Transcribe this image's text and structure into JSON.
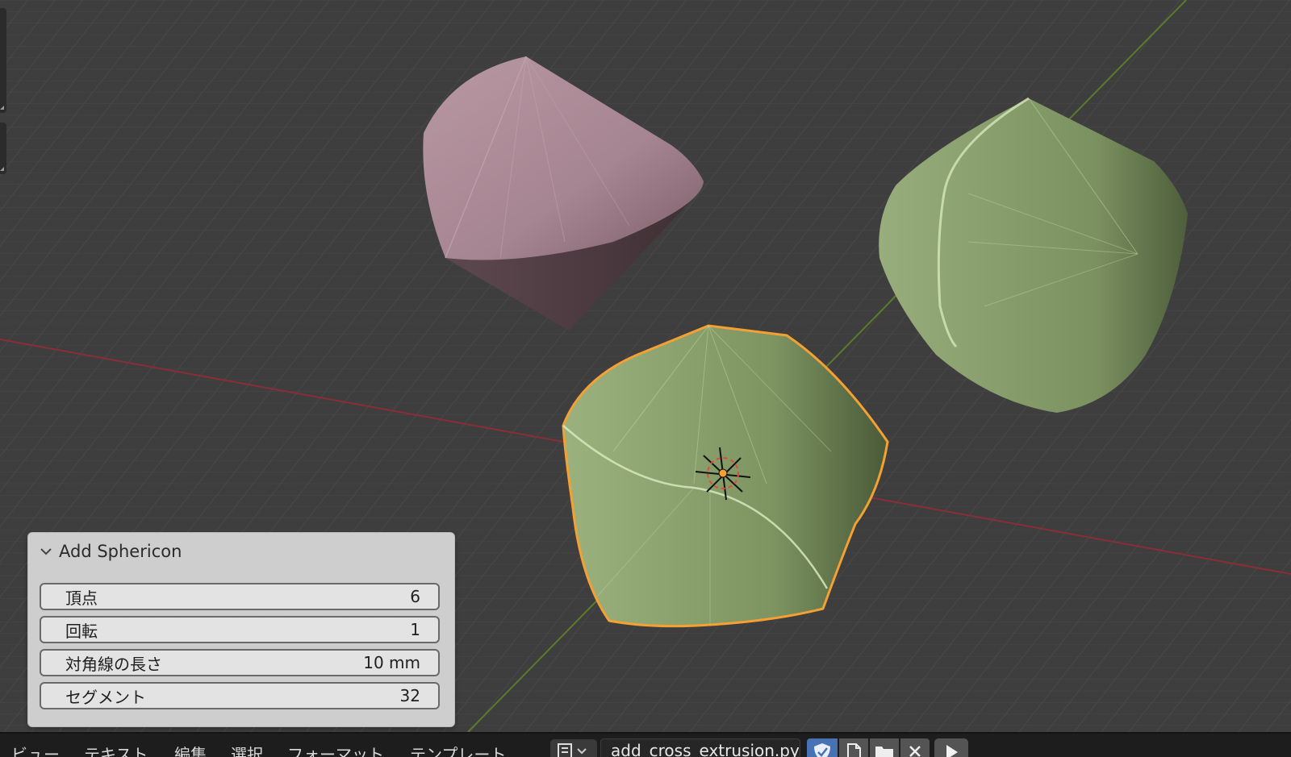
{
  "operator_panel": {
    "title": "Add Sphericon",
    "properties": [
      {
        "label": "頂点",
        "value": "6"
      },
      {
        "label": "回転",
        "value": "1"
      },
      {
        "label": "対角線の長さ",
        "value": "10 mm"
      },
      {
        "label": "セグメント",
        "value": "32"
      }
    ]
  },
  "text_editor_header": {
    "menus": [
      "ビュー",
      "テキスト",
      "編集",
      "選択",
      "フォーマット",
      "テンプレート"
    ],
    "filename": "add_cross_extrusion.py"
  },
  "colors": {
    "viewport_bg": "#3e3e3e",
    "grid": "#4a4a4a",
    "x_axis": "#8a2e36",
    "y_axis": "#5b7a2a",
    "selection_outline": "#f5a033",
    "pink_object": "#b8909a",
    "green_object": "#9db27e"
  },
  "icons": {
    "editor_type": "text-editor-icon",
    "fake_user": "shield-icon",
    "new_text": "new-document-icon",
    "open_text": "folder-icon",
    "unlink": "close-icon",
    "run_script": "play-icon",
    "cursor": "3d-cursor-icon"
  }
}
